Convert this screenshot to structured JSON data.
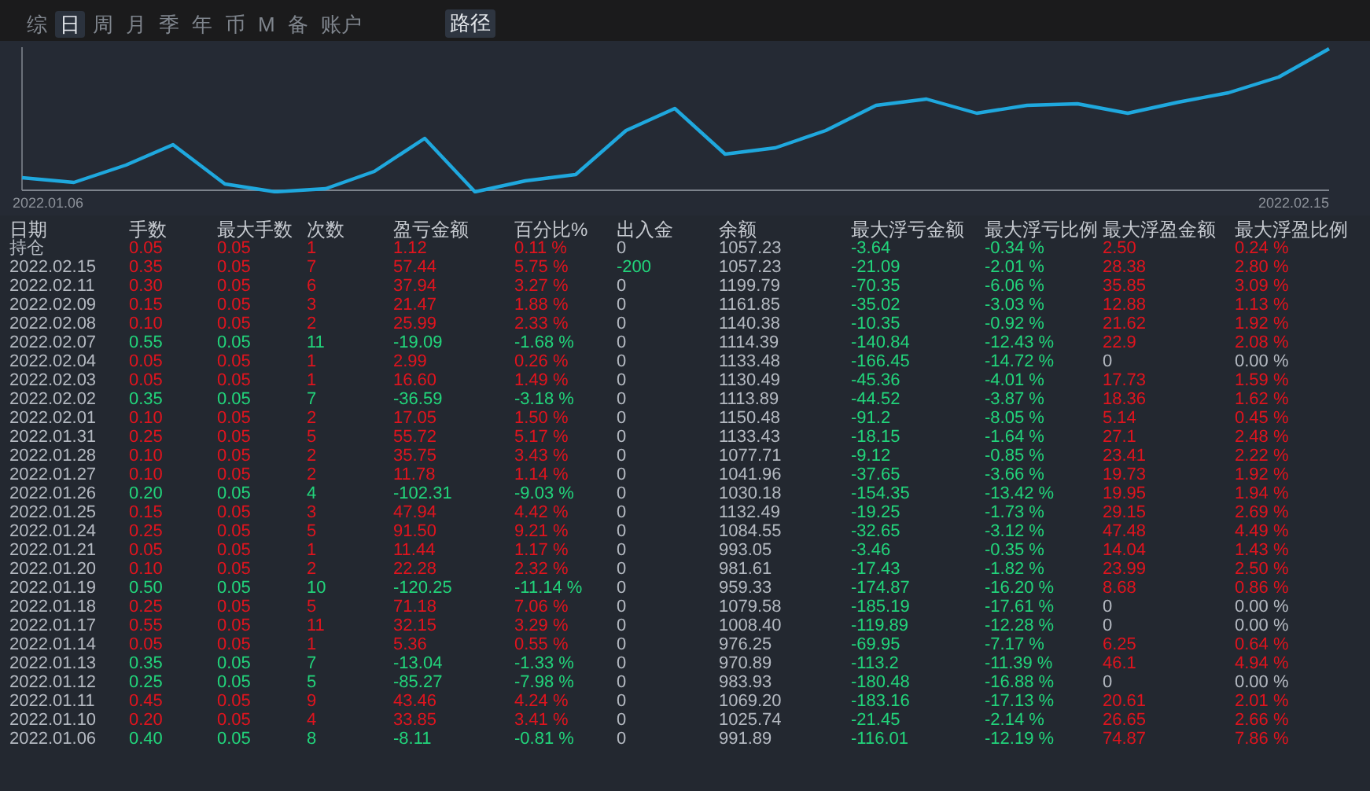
{
  "tabs": [
    {
      "label": "综",
      "selected": false
    },
    {
      "label": "日",
      "selected": true
    },
    {
      "label": "周",
      "selected": false
    },
    {
      "label": "月",
      "selected": false
    },
    {
      "label": "季",
      "selected": false
    },
    {
      "label": "年",
      "selected": false
    },
    {
      "label": "币",
      "selected": false
    },
    {
      "label": "M",
      "selected": false
    },
    {
      "label": "备",
      "selected": false
    },
    {
      "label": "账户",
      "selected": false
    }
  ],
  "path_button": {
    "label": "路径",
    "active": true
  },
  "chart": {
    "start_label": "2022.01.06",
    "end_label": "2022.02.15"
  },
  "table": {
    "columns": [
      "日期",
      "手数",
      "最大手数",
      "次数",
      "盈亏金额",
      "百分比%",
      "出入金",
      "余额",
      "最大浮亏金额",
      "最大浮亏比例",
      "最大浮盈金额",
      "最大浮盈比例"
    ],
    "rows": [
      {
        "loss": false,
        "withdrawal": false,
        "no_gain": false,
        "cells": [
          "持仓",
          "0.05",
          "0.05",
          "1",
          "1.12",
          "0.11 %",
          "0",
          "1057.23",
          "-3.64",
          "-0.34 %",
          "2.50",
          "0.24 %"
        ]
      },
      {
        "loss": false,
        "withdrawal": true,
        "no_gain": false,
        "cells": [
          "2022.02.15",
          "0.35",
          "0.05",
          "7",
          "57.44",
          "5.75 %",
          "-200",
          "1057.23",
          "-21.09",
          "-2.01 %",
          "28.38",
          "2.80 %"
        ]
      },
      {
        "loss": false,
        "withdrawal": false,
        "no_gain": false,
        "cells": [
          "2022.02.11",
          "0.30",
          "0.05",
          "6",
          "37.94",
          "3.27 %",
          "0",
          "1199.79",
          "-70.35",
          "-6.06 %",
          "35.85",
          "3.09 %"
        ]
      },
      {
        "loss": false,
        "withdrawal": false,
        "no_gain": false,
        "cells": [
          "2022.02.09",
          "0.15",
          "0.05",
          "3",
          "21.47",
          "1.88 %",
          "0",
          "1161.85",
          "-35.02",
          "-3.03 %",
          "12.88",
          "1.13 %"
        ]
      },
      {
        "loss": false,
        "withdrawal": false,
        "no_gain": false,
        "cells": [
          "2022.02.08",
          "0.10",
          "0.05",
          "2",
          "25.99",
          "2.33 %",
          "0",
          "1140.38",
          "-10.35",
          "-0.92 %",
          "21.62",
          "1.92 %"
        ]
      },
      {
        "loss": true,
        "withdrawal": false,
        "no_gain": false,
        "cells": [
          "2022.02.07",
          "0.55",
          "0.05",
          "11",
          "-19.09",
          "-1.68 %",
          "0",
          "1114.39",
          "-140.84",
          "-12.43 %",
          "22.9",
          "2.08 %"
        ]
      },
      {
        "loss": false,
        "withdrawal": false,
        "no_gain": true,
        "cells": [
          "2022.02.04",
          "0.05",
          "0.05",
          "1",
          "2.99",
          "0.26 %",
          "0",
          "1133.48",
          "-166.45",
          "-14.72 %",
          "0",
          "0.00 %"
        ]
      },
      {
        "loss": false,
        "withdrawal": false,
        "no_gain": false,
        "cells": [
          "2022.02.03",
          "0.05",
          "0.05",
          "1",
          "16.60",
          "1.49 %",
          "0",
          "1130.49",
          "-45.36",
          "-4.01 %",
          "17.73",
          "1.59 %"
        ]
      },
      {
        "loss": true,
        "withdrawal": false,
        "no_gain": false,
        "cells": [
          "2022.02.02",
          "0.35",
          "0.05",
          "7",
          "-36.59",
          "-3.18 %",
          "0",
          "1113.89",
          "-44.52",
          "-3.87 %",
          "18.36",
          "1.62 %"
        ]
      },
      {
        "loss": false,
        "withdrawal": false,
        "no_gain": false,
        "cells": [
          "2022.02.01",
          "0.10",
          "0.05",
          "2",
          "17.05",
          "1.50 %",
          "0",
          "1150.48",
          "-91.2",
          "-8.05 %",
          "5.14",
          "0.45 %"
        ]
      },
      {
        "loss": false,
        "withdrawal": false,
        "no_gain": false,
        "cells": [
          "2022.01.31",
          "0.25",
          "0.05",
          "5",
          "55.72",
          "5.17 %",
          "0",
          "1133.43",
          "-18.15",
          "-1.64 %",
          "27.1",
          "2.48 %"
        ]
      },
      {
        "loss": false,
        "withdrawal": false,
        "no_gain": false,
        "cells": [
          "2022.01.28",
          "0.10",
          "0.05",
          "2",
          "35.75",
          "3.43 %",
          "0",
          "1077.71",
          "-9.12",
          "-0.85 %",
          "23.41",
          "2.22 %"
        ]
      },
      {
        "loss": false,
        "withdrawal": false,
        "no_gain": false,
        "cells": [
          "2022.01.27",
          "0.10",
          "0.05",
          "2",
          "11.78",
          "1.14 %",
          "0",
          "1041.96",
          "-37.65",
          "-3.66 %",
          "19.73",
          "1.92 %"
        ]
      },
      {
        "loss": true,
        "withdrawal": false,
        "no_gain": false,
        "cells": [
          "2022.01.26",
          "0.20",
          "0.05",
          "4",
          "-102.31",
          "-9.03 %",
          "0",
          "1030.18",
          "-154.35",
          "-13.42 %",
          "19.95",
          "1.94 %"
        ]
      },
      {
        "loss": false,
        "withdrawal": false,
        "no_gain": false,
        "cells": [
          "2022.01.25",
          "0.15",
          "0.05",
          "3",
          "47.94",
          "4.42 %",
          "0",
          "1132.49",
          "-19.25",
          "-1.73 %",
          "29.15",
          "2.69 %"
        ]
      },
      {
        "loss": false,
        "withdrawal": false,
        "no_gain": false,
        "cells": [
          "2022.01.24",
          "0.25",
          "0.05",
          "5",
          "91.50",
          "9.21 %",
          "0",
          "1084.55",
          "-32.65",
          "-3.12 %",
          "47.48",
          "4.49 %"
        ]
      },
      {
        "loss": false,
        "withdrawal": false,
        "no_gain": false,
        "cells": [
          "2022.01.21",
          "0.05",
          "0.05",
          "1",
          "11.44",
          "1.17 %",
          "0",
          "993.05",
          "-3.46",
          "-0.35 %",
          "14.04",
          "1.43 %"
        ]
      },
      {
        "loss": false,
        "withdrawal": false,
        "no_gain": false,
        "cells": [
          "2022.01.20",
          "0.10",
          "0.05",
          "2",
          "22.28",
          "2.32 %",
          "0",
          "981.61",
          "-17.43",
          "-1.82 %",
          "23.99",
          "2.50 %"
        ]
      },
      {
        "loss": true,
        "withdrawal": false,
        "no_gain": false,
        "cells": [
          "2022.01.19",
          "0.50",
          "0.05",
          "10",
          "-120.25",
          "-11.14 %",
          "0",
          "959.33",
          "-174.87",
          "-16.20 %",
          "8.68",
          "0.86 %"
        ]
      },
      {
        "loss": false,
        "withdrawal": false,
        "no_gain": true,
        "cells": [
          "2022.01.18",
          "0.25",
          "0.05",
          "5",
          "71.18",
          "7.06 %",
          "0",
          "1079.58",
          "-185.19",
          "-17.61 %",
          "0",
          "0.00 %"
        ]
      },
      {
        "loss": false,
        "withdrawal": false,
        "no_gain": true,
        "cells": [
          "2022.01.17",
          "0.55",
          "0.05",
          "11",
          "32.15",
          "3.29 %",
          "0",
          "1008.40",
          "-119.89",
          "-12.28 %",
          "0",
          "0.00 %"
        ]
      },
      {
        "loss": false,
        "withdrawal": false,
        "no_gain": false,
        "cells": [
          "2022.01.14",
          "0.05",
          "0.05",
          "1",
          "5.36",
          "0.55 %",
          "0",
          "976.25",
          "-69.95",
          "-7.17 %",
          "6.25",
          "0.64 %"
        ]
      },
      {
        "loss": true,
        "withdrawal": false,
        "no_gain": false,
        "cells": [
          "2022.01.13",
          "0.35",
          "0.05",
          "7",
          "-13.04",
          "-1.33 %",
          "0",
          "970.89",
          "-113.2",
          "-11.39 %",
          "46.1",
          "4.94 %"
        ]
      },
      {
        "loss": true,
        "withdrawal": false,
        "no_gain": true,
        "cells": [
          "2022.01.12",
          "0.25",
          "0.05",
          "5",
          "-85.27",
          "-7.98 %",
          "0",
          "983.93",
          "-180.48",
          "-16.88 %",
          "0",
          "0.00 %"
        ]
      },
      {
        "loss": false,
        "withdrawal": false,
        "no_gain": false,
        "cells": [
          "2022.01.11",
          "0.45",
          "0.05",
          "9",
          "43.46",
          "4.24 %",
          "0",
          "1069.20",
          "-183.16",
          "-17.13 %",
          "20.61",
          "2.01 %"
        ]
      },
      {
        "loss": false,
        "withdrawal": false,
        "no_gain": false,
        "cells": [
          "2022.01.10",
          "0.20",
          "0.05",
          "4",
          "33.85",
          "3.41 %",
          "0",
          "1025.74",
          "-21.45",
          "-2.14 %",
          "26.65",
          "2.66 %"
        ]
      },
      {
        "loss": true,
        "withdrawal": false,
        "no_gain": false,
        "cells": [
          "2022.01.06",
          "0.40",
          "0.05",
          "8",
          "-8.11",
          "-0.81 %",
          "0",
          "991.89",
          "-116.01",
          "-12.19 %",
          "74.87",
          "7.86 %"
        ]
      }
    ]
  }
}
